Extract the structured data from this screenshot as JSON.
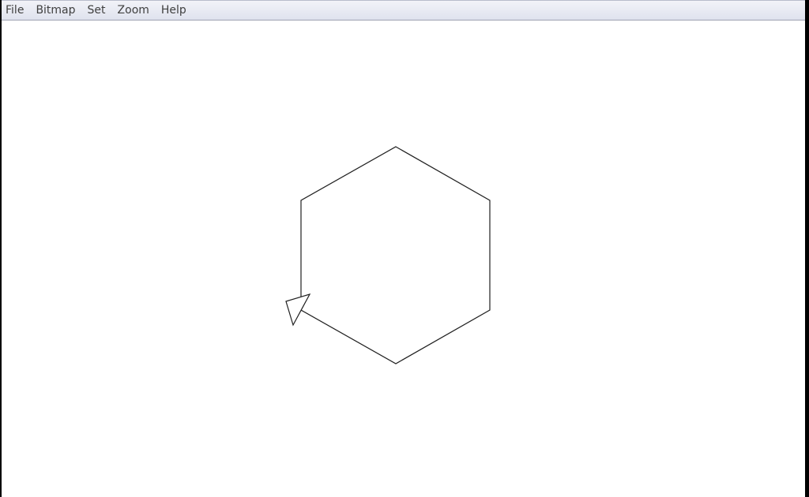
{
  "menu": {
    "items": [
      {
        "label": "File"
      },
      {
        "label": "Bitmap"
      },
      {
        "label": "Set"
      },
      {
        "label": "Zoom"
      },
      {
        "label": "Help"
      }
    ]
  },
  "canvas": {
    "background": "#ffffff",
    "stroke_color": "#202020",
    "shape": "hexagon",
    "turtle": "triangle-cursor"
  }
}
